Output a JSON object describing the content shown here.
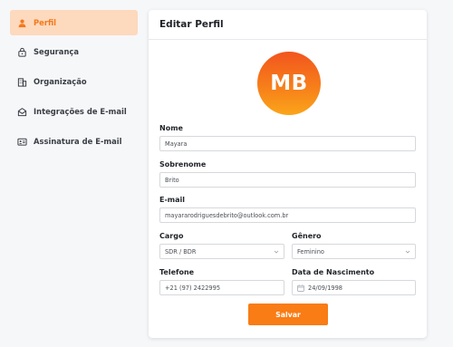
{
  "sidebar": {
    "items": [
      {
        "label": "Perfil",
        "icon": "user-icon",
        "active": true
      },
      {
        "label": "Segurança",
        "icon": "lock-icon",
        "active": false
      },
      {
        "label": "Organização",
        "icon": "building-icon",
        "active": false
      },
      {
        "label": "Integrações de E-mail",
        "icon": "mail-open-icon",
        "active": false
      },
      {
        "label": "Assinatura de E-mail",
        "icon": "id-card-icon",
        "active": false
      }
    ]
  },
  "form": {
    "title": "Editar Perfil",
    "avatar_initials": "MB",
    "nome": {
      "label": "Nome",
      "value": "Mayara"
    },
    "sobrenome": {
      "label": "Sobrenome",
      "value": "Brito"
    },
    "email": {
      "label": "E-mail",
      "value": "mayararodriguesdebrito@outlook.com.br"
    },
    "cargo": {
      "label": "Cargo",
      "value": "SDR / BDR"
    },
    "genero": {
      "label": "Gênero",
      "value": "Feminino"
    },
    "telefone": {
      "label": "Telefone",
      "value": "+21 (97) 2422995"
    },
    "nascimento": {
      "label": "Data de Nascimento",
      "value": "24/09/1998"
    },
    "save_label": "Salvar"
  },
  "colors": {
    "accent": "#f97c14",
    "active_bg": "#fdd9bd",
    "avatar_gradient_top": "#f2551e",
    "avatar_gradient_bottom": "#fba51a"
  }
}
